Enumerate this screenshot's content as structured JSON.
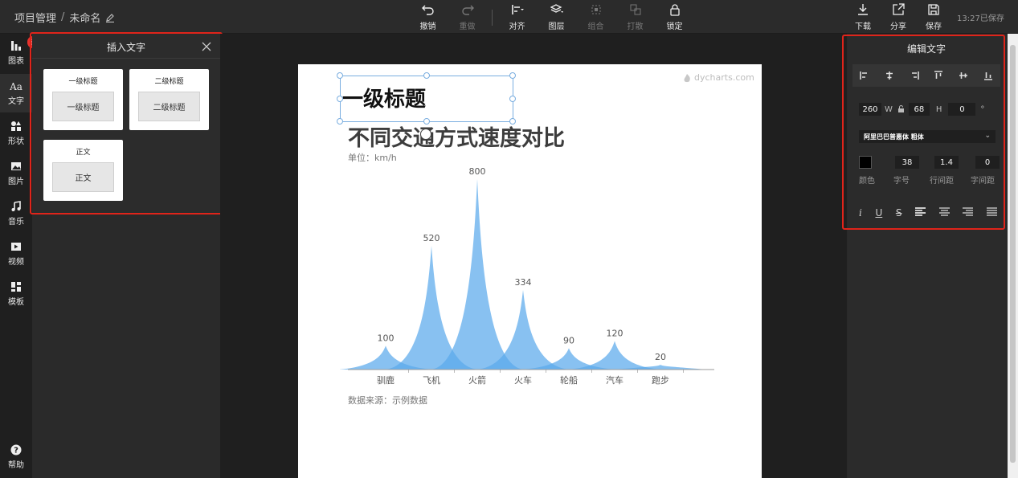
{
  "breadcrumb": {
    "project": "项目管理",
    "separator": "/",
    "file_name": "未命名"
  },
  "toolbar": {
    "undo": "撤销",
    "redo": "重做",
    "align": "对齐",
    "layer": "图层",
    "group": "组合",
    "ungroup": "打散",
    "lock": "锁定",
    "download": "下载",
    "share": "分享",
    "save": "保存",
    "save_status": "13:27已保存"
  },
  "sidebar": {
    "items": [
      {
        "label": "图表",
        "icon": "chart-icon"
      },
      {
        "label": "文字",
        "icon": "text-icon"
      },
      {
        "label": "形状",
        "icon": "shapes-icon"
      },
      {
        "label": "图片",
        "icon": "image-icon"
      },
      {
        "label": "音乐",
        "icon": "music-icon"
      },
      {
        "label": "视频",
        "icon": "video-icon"
      },
      {
        "label": "模板",
        "icon": "template-icon"
      }
    ],
    "help": "帮助",
    "new_badge": "新"
  },
  "insert_panel": {
    "title": "插入文字",
    "cards": [
      {
        "title": "一级标题",
        "button": "一级标题"
      },
      {
        "title": "二级标题",
        "button": "二级标题"
      },
      {
        "title": "正文",
        "button": "正文"
      }
    ]
  },
  "canvas": {
    "watermark": "dycharts.com",
    "selected_heading": "一级标题",
    "chart_title": "不同交通方式速度对比",
    "unit": "单位：km/h",
    "source": "数据来源：示例数据"
  },
  "chart_data": {
    "type": "area",
    "title": "不同交通方式速度对比",
    "categories": [
      "驯鹿",
      "飞机",
      "火箭",
      "火车",
      "轮船",
      "汽车",
      "跑步"
    ],
    "values": [
      100,
      520,
      800,
      334,
      90,
      120,
      20
    ],
    "ylim": [
      0,
      800
    ],
    "color": "#5aa9ec",
    "grid": false,
    "legend": "none"
  },
  "edit_panel": {
    "title": "编辑文字",
    "width": "260",
    "width_label": "W",
    "height": "68",
    "height_label": "H",
    "rotation": "0",
    "rotation_unit": "°",
    "font": "阿里巴巴普惠体 粗体",
    "color": "#000000",
    "font_size": "38",
    "line_height": "1.4",
    "letter_spacing": "0",
    "color_label": "颜色",
    "font_size_label": "字号",
    "line_height_label": "行间距",
    "letter_spacing_label": "字间距"
  }
}
